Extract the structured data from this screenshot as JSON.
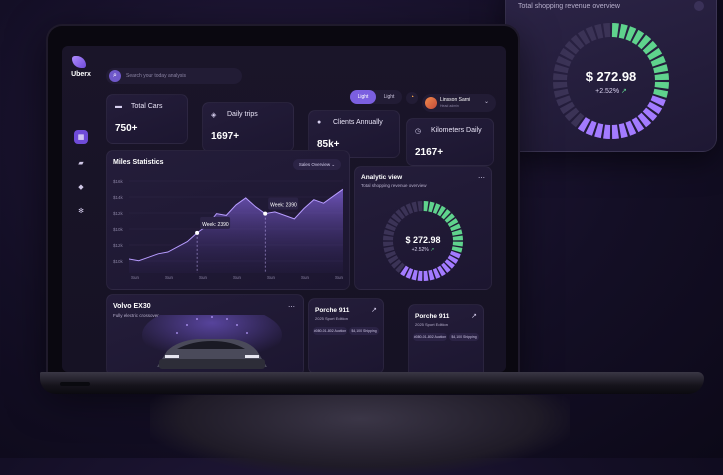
{
  "floating_card": {
    "subtitle": "Total shopping revenue overview",
    "value": "$ 272.98",
    "change": "+2.52%",
    "trend_icon": "arrow-up-right-icon"
  },
  "app": {
    "name": "Uberx"
  },
  "search": {
    "placeholder": "Search your today analysis"
  },
  "theme_toggle": {
    "options": [
      "Light",
      "Light"
    ],
    "selected": 0
  },
  "profile": {
    "name": "Linsson Sarni",
    "role": "Head admin"
  },
  "sidebar": {
    "items": [
      {
        "icon": "dashboard-icon",
        "active": true
      },
      {
        "icon": "truck-icon",
        "active": false
      },
      {
        "icon": "bag-icon",
        "active": false
      },
      {
        "icon": "gear-icon",
        "active": false
      }
    ]
  },
  "stats": [
    {
      "label": "Total Cars",
      "value": "750+",
      "icon": "car-icon"
    },
    {
      "label": "Daily trips",
      "value": "1697+",
      "icon": "route-icon"
    },
    {
      "label": "Clients Annually",
      "value": "85k+",
      "icon": "user-icon"
    },
    {
      "label": "Kilometers Daily",
      "value": "2167+",
      "icon": "clock-icon"
    }
  ],
  "miles": {
    "title": "Miles Statistics",
    "dropdown": "Sales Overview",
    "tooltips": [
      {
        "label": "Week",
        "value": "2390"
      },
      {
        "label": "Week",
        "value": "2390"
      }
    ]
  },
  "chart_data": {
    "type": "area",
    "title": "Miles Statistics",
    "yticks": [
      "$16k",
      "$14k",
      "$12k",
      "$10k",
      "$12k",
      "$10k"
    ],
    "xticks": [
      "Sun",
      "Sun",
      "Sun",
      "Sun",
      "Sun",
      "Sun",
      "Sun"
    ],
    "series": [
      {
        "values": [
          10.3,
          10.2,
          10.4,
          10.6,
          10.7,
          11.0,
          11.3,
          11.8,
          12.2,
          12.9,
          12.8,
          13.4,
          13.8,
          13.3,
          12.9,
          13.0,
          12.8,
          12.6,
          13.2,
          13.7,
          13.5,
          13.9,
          14.3
        ]
      }
    ],
    "grid": true
  },
  "analytic": {
    "title": "Analytic view",
    "subtitle": "Total shopping revenue overview",
    "value": "$ 272.98",
    "change": "+2.52%",
    "ring": {
      "purple_fraction": 0.3,
      "green_fraction": 0.3,
      "gray_fraction": 0.4
    }
  },
  "car_card": {
    "title": "Volvo EX30",
    "subtitle": "Fully electric crossover"
  },
  "porsche_cards": [
    {
      "title": "Porche 911",
      "subtitle": "2025 Sport Edition",
      "chips": [
        "#080-01-802 Auction",
        "$4,100 Shipping"
      ]
    },
    {
      "title": "Porche 911",
      "subtitle": "2025 Sport Edition",
      "chips": [
        "#080-01-802 Auction",
        "$4,100 Shipping"
      ]
    }
  ],
  "colors": {
    "accent": "#7b5fe0",
    "green": "#5fd38d",
    "purple": "#a37bff",
    "bg": "#140f26"
  }
}
